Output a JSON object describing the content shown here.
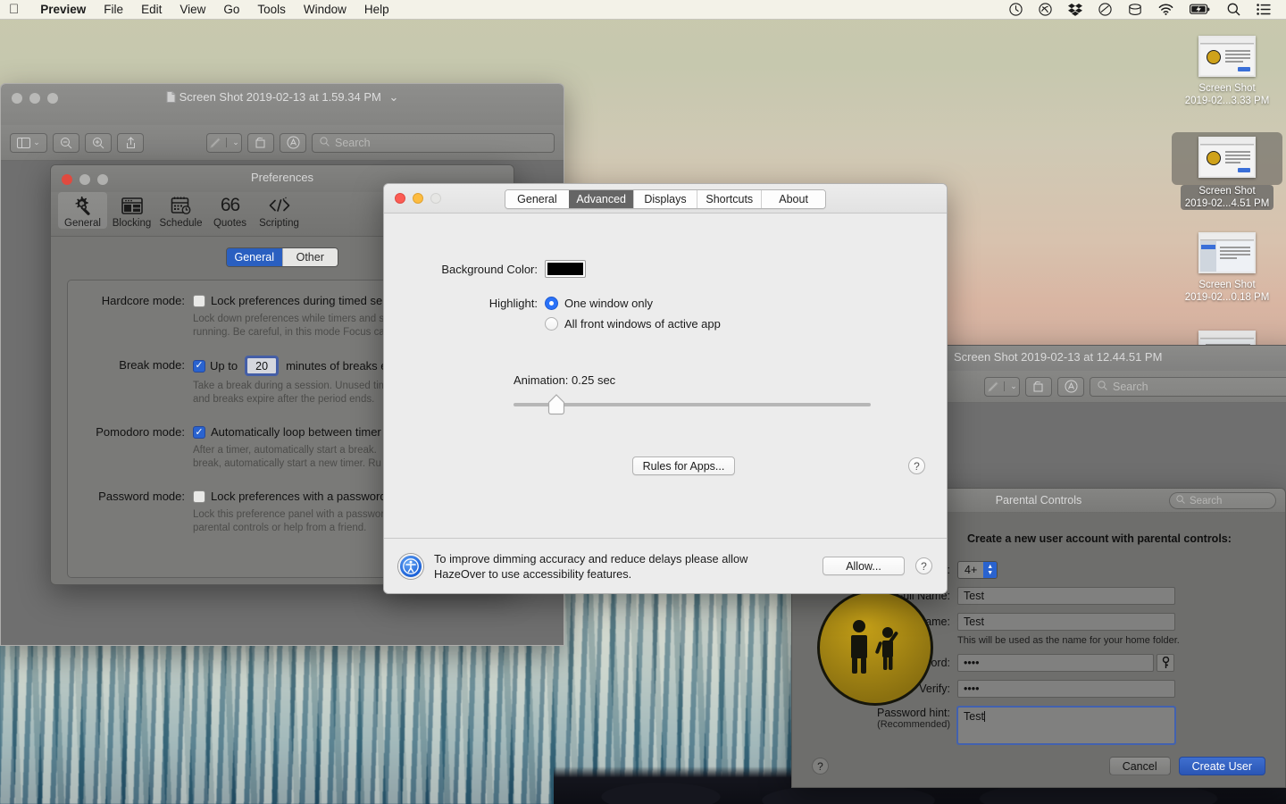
{
  "menubar": {
    "apple_icon": "apple-icon",
    "items": [
      {
        "label": "Preview",
        "bold": true
      },
      {
        "label": "File"
      },
      {
        "label": "Edit"
      },
      {
        "label": "View"
      },
      {
        "label": "Go"
      },
      {
        "label": "Tools"
      },
      {
        "label": "Window"
      },
      {
        "label": "Help"
      }
    ],
    "status_icons": [
      "timemachine-icon",
      "cloud-sync-icon",
      "dropbox-icon",
      "backblaze-icon",
      "disk-icon",
      "wifi-icon",
      "battery-charging-icon",
      "spotlight-search-icon",
      "control-center-icon"
    ]
  },
  "desktop": {
    "icons": [
      {
        "name": "Screen Shot",
        "line2": "2019-02...3.33 PM",
        "selected": false,
        "thumb": "dialog"
      },
      {
        "name": "Screen Shot",
        "line2": "2019-02...4.51 PM",
        "selected": true,
        "thumb": "dialog"
      },
      {
        "name": "Screen Shot",
        "line2": "2019-02...0.18 PM",
        "selected": false,
        "thumb": "window"
      },
      {
        "name": "",
        "line2": "",
        "selected": false,
        "thumb": "window"
      }
    ]
  },
  "preview_window": {
    "title": "Screen Shot 2019-02-13 at 1.59.34 PM",
    "title_chevron": "chevron-down-icon",
    "doc_icon": "document-icon",
    "toolbar": {
      "sidebar_icon": "sidebar-icon",
      "zoom_out_icon": "zoom-out-icon",
      "zoom_in_icon": "zoom-in-icon",
      "share_icon": "share-icon",
      "markup_icon": "markup-pen-icon",
      "markup_chevron": "chevron-down-icon",
      "rotate_icon": "rotate-icon",
      "annotate_icon": "annotate-icon",
      "search_placeholder": "Search",
      "search_icon": "search-icon"
    }
  },
  "preview_window2": {
    "title": "Screen Shot 2019-02-13 at 12.44.51 PM",
    "toolbar": {
      "markup_icon": "markup-pen-icon",
      "markup_chevron": "chevron-down-icon",
      "rotate_icon": "rotate-icon",
      "annotate_icon": "annotate-icon",
      "search_placeholder": "Search",
      "search_icon": "search-icon"
    }
  },
  "preferences_window": {
    "title": "Preferences",
    "toolbar_tabs": [
      {
        "label": "General",
        "icon": "gear-wrench-icon",
        "active": true
      },
      {
        "label": "Blocking",
        "icon": "blocking-window-icon",
        "active": false
      },
      {
        "label": "Schedule",
        "icon": "calendar-clock-icon",
        "active": false
      },
      {
        "label": "Quotes",
        "icon": "quotes-icon",
        "active": false
      },
      {
        "label": "Scripting",
        "icon": "code-tag-icon",
        "active": false
      }
    ],
    "segmented": {
      "selected": "General",
      "other": "Other"
    },
    "settings": [
      {
        "label": "Hardcore mode:",
        "checked": false,
        "checkbox_label": "Lock preferences during timed se",
        "description_line1": "Lock down preferences while timers and s",
        "description_line2": "running. Be careful, in this mode Focus ca"
      },
      {
        "label": "Break mode:",
        "checked": true,
        "prefix": "Up to",
        "value": "20",
        "suffix": "minutes of breaks eve",
        "description_line1": "Take a break during a session. Unused tim",
        "description_line2": "and breaks expire after the period ends."
      },
      {
        "label": "Pomodoro mode:",
        "checked": true,
        "checkbox_label": "Automatically loop between timer",
        "description_line1": "After a timer, automatically start a break. ",
        "description_line2": "break, automatically start a new timer. Ru"
      },
      {
        "label": "Password mode:",
        "checked": false,
        "checkbox_label": "Lock preferences with a password",
        "description_line1": "Lock this preference panel with a passwor",
        "description_line2": "parental controls or help from a friend."
      }
    ]
  },
  "hazeover_window": {
    "tabs": [
      {
        "label": "General",
        "active": false
      },
      {
        "label": "Advanced",
        "active": true
      },
      {
        "label": "Displays",
        "active": false
      },
      {
        "label": "Shortcuts",
        "active": false
      },
      {
        "label": "About",
        "active": false
      }
    ],
    "background_color_label": "Background Color:",
    "background_color_value": "#000000",
    "highlight_label": "Highlight:",
    "highlight_options": [
      {
        "label": "One window only",
        "selected": true
      },
      {
        "label": "All front windows of active app",
        "selected": false
      }
    ],
    "animation_label": "Animation: 0.25 sec",
    "animation_value": 0.25,
    "animation_percent": 10,
    "rules_button": "Rules for Apps...",
    "help_label": "?",
    "notice": {
      "icon": "accessibility-icon",
      "line1": "To improve dimming accuracy and reduce delays please allow",
      "line2": "HazeOver to use accessibility features.",
      "allow_button": "Allow...",
      "help_label": "?"
    }
  },
  "parental_controls": {
    "title": "Parental Controls",
    "search_placeholder": "Search",
    "search_icon": "search-icon",
    "badge_icon": "parental-controls-icon",
    "heading": "Create a new user account with parental controls:",
    "fields": [
      {
        "label": "Age:",
        "type": "stepper",
        "value": "4+"
      },
      {
        "label": "Full Name:",
        "type": "text",
        "value": "Test"
      },
      {
        "label": "Account Name:",
        "type": "text",
        "value": "Test",
        "help": "This will be used as the name for your home folder."
      },
      {
        "label": "Password:",
        "type": "password",
        "value": "••••",
        "key_icon": "key-icon"
      },
      {
        "label": "Verify:",
        "type": "password",
        "value": "••••"
      }
    ],
    "hint": {
      "label": "Password hint:",
      "sublabel": "(Recommended)",
      "value": "Test"
    },
    "help_label": "?",
    "cancel_button": "Cancel",
    "create_button": "Create User"
  }
}
